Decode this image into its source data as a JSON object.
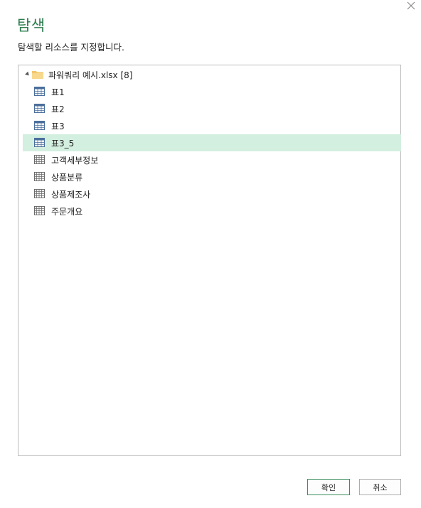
{
  "dialog": {
    "title": "탐색",
    "subtitle": "탐색할 리소스를 지정합니다."
  },
  "tree": {
    "root": {
      "label": "파워쿼리 예시.xlsx [8]",
      "expanded": true
    },
    "items": [
      {
        "label": "표1",
        "kind": "table",
        "selected": false
      },
      {
        "label": "표2",
        "kind": "table",
        "selected": false
      },
      {
        "label": "표3",
        "kind": "table",
        "selected": false
      },
      {
        "label": "표3_5",
        "kind": "table",
        "selected": true
      },
      {
        "label": "고객세부정보",
        "kind": "sheet",
        "selected": false
      },
      {
        "label": "상품분류",
        "kind": "sheet",
        "selected": false
      },
      {
        "label": "상품제조사",
        "kind": "sheet",
        "selected": false
      },
      {
        "label": "주문개요",
        "kind": "sheet",
        "selected": false
      }
    ]
  },
  "buttons": {
    "ok": "확인",
    "cancel": "취소"
  },
  "colors": {
    "accent": "#2e7d4f",
    "selected_row": "#d3efdf",
    "table_icon": "#4a6f9c"
  }
}
